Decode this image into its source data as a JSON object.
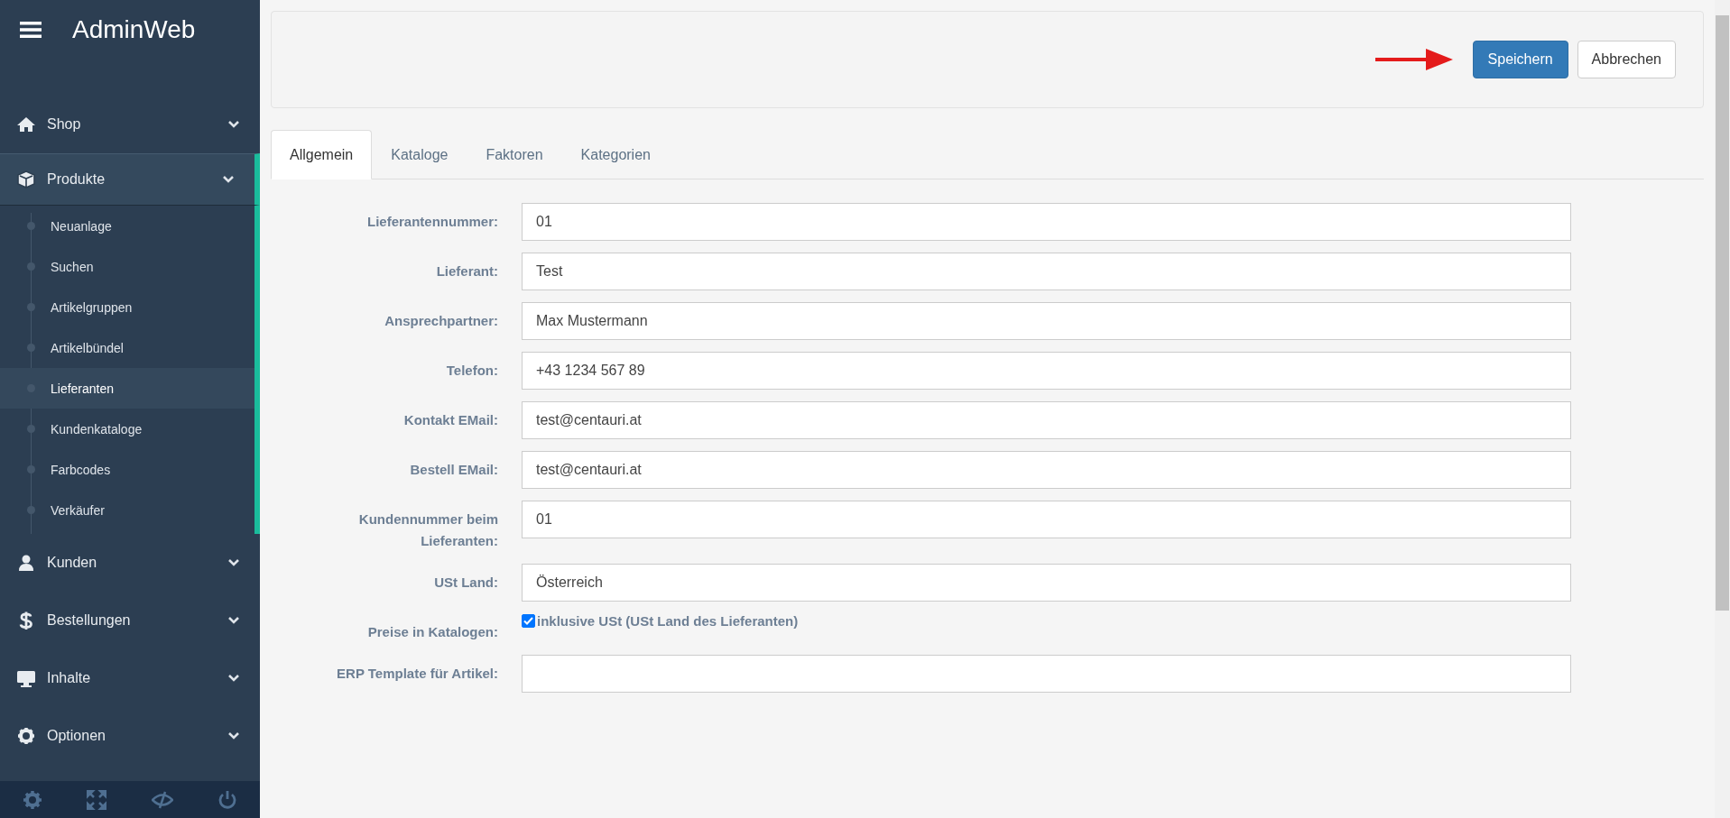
{
  "sidebar": {
    "title": "AdminWeb",
    "items": [
      {
        "label": "Shop",
        "expanded": false
      },
      {
        "label": "Produkte",
        "expanded": true,
        "children": [
          {
            "label": "Neuanlage",
            "selected": false
          },
          {
            "label": "Suchen",
            "selected": false
          },
          {
            "label": "Artikelgruppen",
            "selected": false
          },
          {
            "label": "Artikelbündel",
            "selected": false
          },
          {
            "label": "Lieferanten",
            "selected": true
          },
          {
            "label": "Kundenkataloge",
            "selected": false
          },
          {
            "label": "Farbcodes",
            "selected": false
          },
          {
            "label": "Verkäufer",
            "selected": false
          }
        ]
      },
      {
        "label": "Kunden",
        "expanded": false
      },
      {
        "label": "Bestellungen",
        "expanded": false
      },
      {
        "label": "Inhalte",
        "expanded": false
      },
      {
        "label": "Optionen",
        "expanded": false
      }
    ]
  },
  "toolbar": {
    "save": "Speichern",
    "cancel": "Abbrechen"
  },
  "tabs": [
    {
      "label": "Allgemein",
      "selected": true
    },
    {
      "label": "Kataloge",
      "selected": false
    },
    {
      "label": "Faktoren",
      "selected": false
    },
    {
      "label": "Kategorien",
      "selected": false
    }
  ],
  "form": [
    {
      "kind": "text",
      "label": "Lieferantennummer:",
      "value": "01"
    },
    {
      "kind": "text",
      "label": "Lieferant:",
      "value": "Test"
    },
    {
      "kind": "text",
      "label": "Ansprechpartner:",
      "value": "Max Mustermann"
    },
    {
      "kind": "text",
      "label": "Telefon:",
      "value": "+43 1234 567 89"
    },
    {
      "kind": "text",
      "label": "Kontakt EMail:",
      "value": "test@centauri.at"
    },
    {
      "kind": "text",
      "label": "Bestell EMail:",
      "value": "test@centauri.at"
    },
    {
      "kind": "text",
      "label": "Kundennummer beim Lieferanten:",
      "value": "01"
    },
    {
      "kind": "text",
      "label": "USt Land:",
      "value": "Österreich"
    },
    {
      "kind": "checkbox",
      "label": "Preise in Katalogen:",
      "checked": true,
      "text": "inklusive USt (USt Land des Lieferanten)"
    },
    {
      "kind": "text",
      "label": "ERP Template für Artikel:"
    }
  ]
}
